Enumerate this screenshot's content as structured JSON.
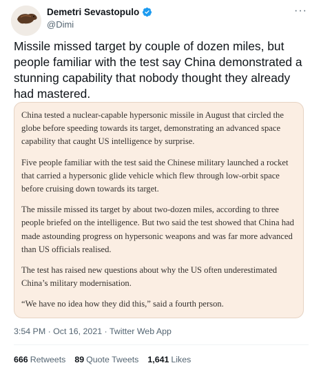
{
  "author": {
    "display_name": "Demetri Sevastopulo",
    "handle": "@Dimi",
    "avatar_icon": "bird-avatar",
    "verified_icon": "verified-badge-icon",
    "verified_color": "#1d9bf0"
  },
  "more_icon": "···",
  "tweet": {
    "text": "Missile missed target by couple of dozen miles, but people familiar with the test say China demonstrated a stunning capability that nobody thought they already had mastered."
  },
  "card": {
    "background_color": "#fbeee3",
    "paragraphs": [
      "China tested a nuclear-capable hypersonic missile in August that circled the globe before speeding towards its target, demonstrating an advanced space capability that caught US intelligence by surprise.",
      "Five people familiar with the test said the Chinese military launched a rocket that carried a hypersonic glide vehicle which flew through low-orbit space before cruising down towards its target.",
      "The missile missed its target by about two-dozen miles, according to three people briefed on the intelligence. But two said the test showed that China had made astounding progress on hypersonic weapons and was far more advanced than US officials realised.",
      "The test has raised new questions about why the US often underestimated China’s military modernisation.",
      "“We have no idea how they did this,” said a fourth person."
    ]
  },
  "meta": {
    "timestamp": "3:54 PM · Oct 16, 2021",
    "separator": " · ",
    "source": "Twitter Web App"
  },
  "stats": {
    "retweets_count": "666",
    "retweets_label": "Retweets",
    "quotes_count": "89",
    "quotes_label": "Quote Tweets",
    "likes_count": "1,641",
    "likes_label": "Likes"
  }
}
